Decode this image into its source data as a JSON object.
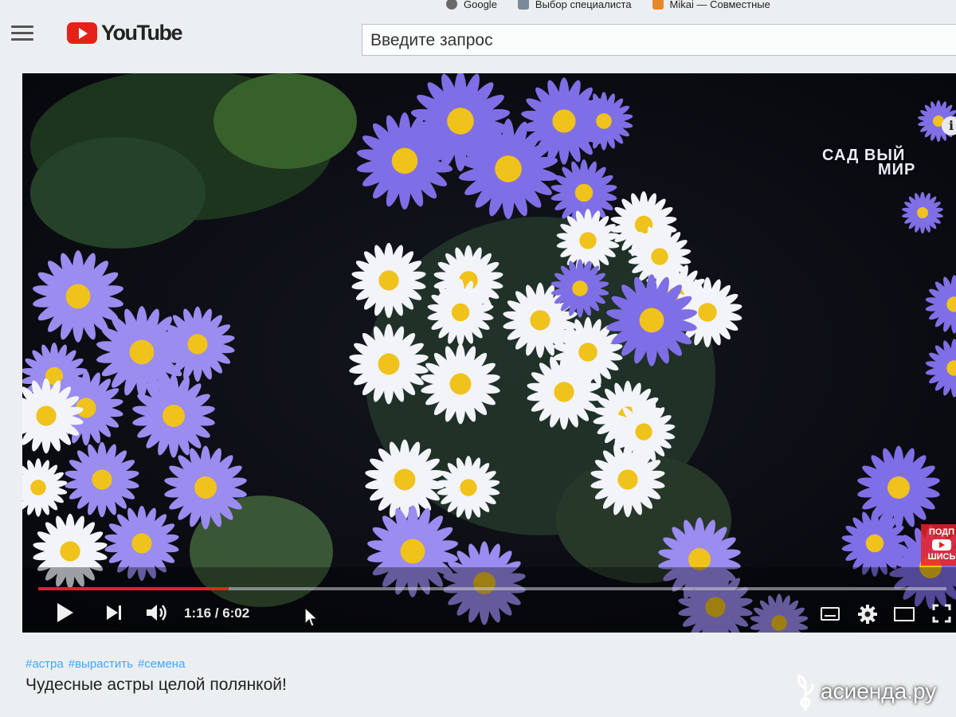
{
  "bookmarks": [
    {
      "label": "Google",
      "icon": "google-icon"
    },
    {
      "label": "Выбор специалиста",
      "icon": "bookmark-icon"
    },
    {
      "label": "Mikai — Совместные",
      "icon": "bookmark-icon"
    }
  ],
  "header": {
    "logo_text": "YouTube",
    "search_placeholder": "Введите запрос"
  },
  "player": {
    "watermark_line1": "САД ВЫЙ",
    "watermark_line2": "МИР",
    "info_label": "i",
    "subscribe_line1": "ПОДП",
    "subscribe_line2": "ШИСЬ",
    "time_display": "1:16 / 6:02",
    "progress_fraction": 0.21,
    "accent_color": "#e2231f"
  },
  "video": {
    "hashtags": [
      "#астра",
      "#вырастить",
      "#семена"
    ],
    "title": "Чудесные астры целой полянкой!"
  },
  "overlay_brand": "асиенда.ру"
}
